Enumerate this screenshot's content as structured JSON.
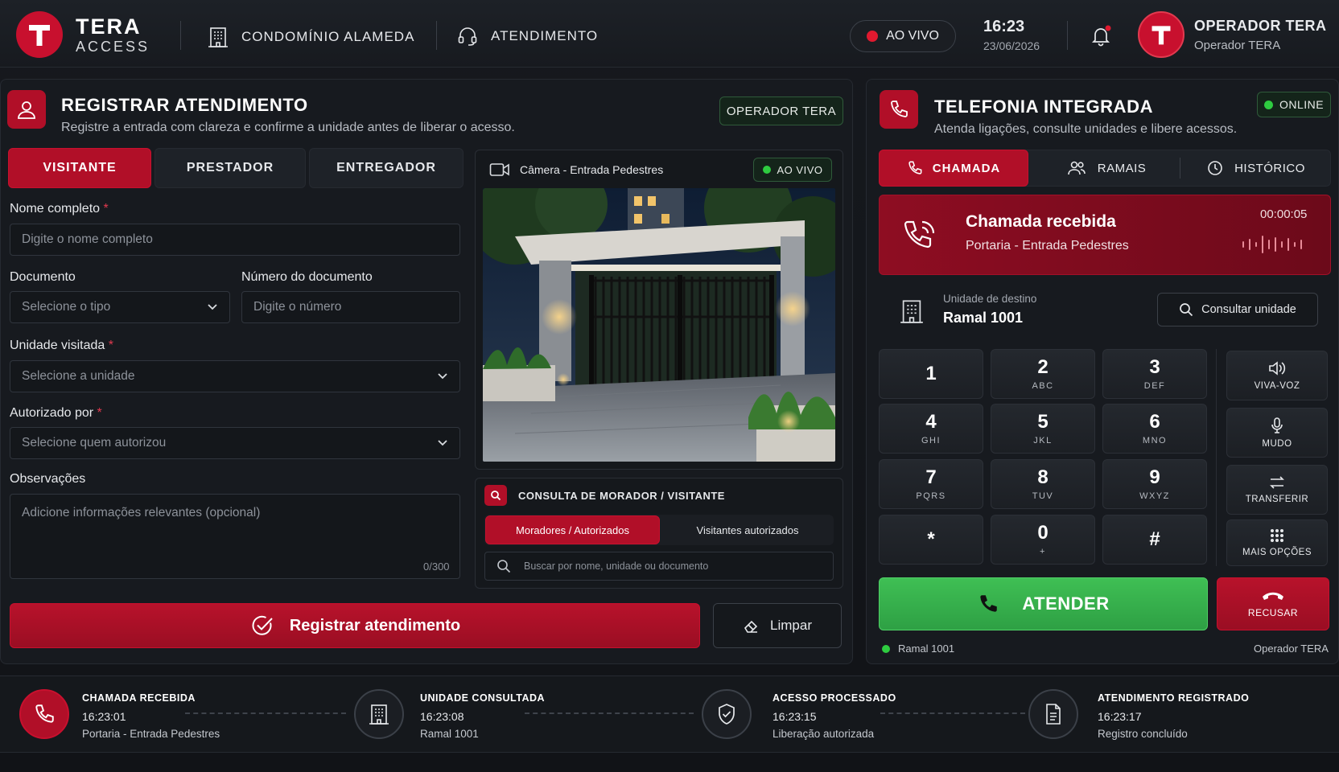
{
  "header": {
    "brand_line1": "TERA",
    "brand_line2": "ACCESS",
    "nav_condo": "CONDOMÍNIO ALAMEDA",
    "nav_attendance": "ATENDIMENTO",
    "live_label": "AO VIVO",
    "time": "16:23",
    "date": "23/06/2026",
    "user_name": "OPERADOR TERA",
    "user_role": "Operador TERA"
  },
  "register": {
    "title": "REGISTRAR ATENDIMENTO",
    "subtitle": "Registre a entrada com clareza e confirme a unidade antes de liberar o acesso.",
    "operator_badge": "OPERADOR TERA",
    "tabs": [
      "VISITANTE",
      "PRESTADOR",
      "ENTREGADOR"
    ],
    "active_tab": 0,
    "full_name_label": "Nome completo",
    "full_name_placeholder": "Digite o nome completo",
    "document_label": "Documento",
    "document_placeholder": "Selecione o tipo",
    "doc_number_label": "Número do documento",
    "doc_number_placeholder": "Digite o número",
    "unit_label": "Unidade visitada",
    "unit_placeholder": "Selecione a unidade",
    "authorized_label": "Autorizado por",
    "authorized_placeholder": "Selecione quem autorizou",
    "notes_label": "Observações",
    "notes_placeholder": "Adicione informações relevantes (opcional)",
    "notes_counter": "0/300",
    "required_mark": "*",
    "submit_label": "Registrar atendimento",
    "clear_label": "Limpar"
  },
  "camera": {
    "title": "Câmera - Entrada Pedestres",
    "live_label": "AO VIVO"
  },
  "lookup": {
    "title": "CONSULTA DE MORADOR / VISITANTE",
    "tabs": [
      "Moradores / Autorizados",
      "Visitantes autorizados"
    ],
    "search_placeholder": "Buscar por nome, unidade ou documento"
  },
  "telephony": {
    "title": "TELEFONIA INTEGRADA",
    "subtitle": "Atenda ligações, consulte unidades e libere acessos.",
    "status": "ONLINE",
    "tabs": [
      "CHAMADA",
      "RAMAIS",
      "HISTÓRICO"
    ],
    "call_title": "Chamada recebida",
    "call_origin": "Portaria - Entrada Pedestres",
    "call_timer": "00:00:05",
    "dest_label": "Unidade de destino",
    "dest_value": "Ramal 1001",
    "consult_label": "Consultar unidade",
    "keys": [
      {
        "k": "1",
        "s": ""
      },
      {
        "k": "2",
        "s": "ABC"
      },
      {
        "k": "3",
        "s": "DEF"
      },
      {
        "k": "4",
        "s": "GHI"
      },
      {
        "k": "5",
        "s": "JKL"
      },
      {
        "k": "6",
        "s": "MNO"
      },
      {
        "k": "7",
        "s": "PQRS"
      },
      {
        "k": "8",
        "s": "TUV"
      },
      {
        "k": "9",
        "s": "WXYZ"
      },
      {
        "k": "*",
        "s": ""
      },
      {
        "k": "0",
        "s": "+"
      },
      {
        "k": "#",
        "s": ""
      }
    ],
    "side_buttons": [
      "VIVA-VOZ",
      "MUDO",
      "TRANSFERIR",
      "MAIS OPÇÕES"
    ],
    "answer_label": "ATENDER",
    "decline_label": "RECUSAR",
    "footer_ext": "Ramal 1001",
    "footer_operator": "Operador TERA"
  },
  "timeline": [
    {
      "title": "CHAMADA RECEBIDA",
      "time": "16:23:01",
      "detail": "Portaria - Entrada Pedestres",
      "icon": "phone-icon"
    },
    {
      "title": "UNIDADE CONSULTADA",
      "time": "16:23:08",
      "detail": "Ramal 1001",
      "icon": "building-icon"
    },
    {
      "title": "ACESSO PROCESSADO",
      "time": "16:23:15",
      "detail": "Liberação autorizada",
      "icon": "shield-check-icon"
    },
    {
      "title": "ATENDIMENTO REGISTRADO",
      "time": "16:23:17",
      "detail": "Registro concluído",
      "icon": "document-icon"
    }
  ],
  "colors": {
    "accent_red": "#c8102e",
    "live_red": "#e0192f",
    "online_green": "#2ecc40",
    "answer_green": "#35b34a",
    "background": "#14171b"
  }
}
